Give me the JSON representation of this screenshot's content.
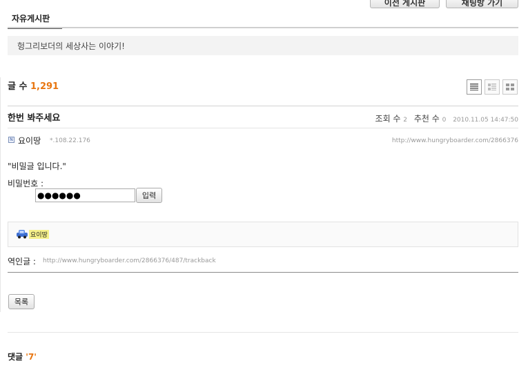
{
  "header": {
    "prev_button": "이전 게시판",
    "chat_button": "채팅방 가기"
  },
  "board": {
    "tab_title": "자유게시판",
    "description": "헝그리보더의 세상사는 이야기!",
    "count_label": "글 수",
    "count_value": "1,291"
  },
  "view_modes": [
    "list-view-icon",
    "summary-view-icon",
    "grid-view-icon"
  ],
  "post": {
    "title": "한번 봐주세요",
    "views_label": "조회 수",
    "views": "2",
    "recommend_label": "추천 수",
    "recommend": "0",
    "datetime": "2010.11.05 14:47:50",
    "author": "요이땅",
    "ip": "*.108.22.176",
    "url": "http://www.hungryboarder.com/2866376",
    "secret_message": "\"비밀글 입니다.\"",
    "password_label": "비밀번호 :",
    "password_value": "●●●●●●",
    "submit_label": "입력",
    "signature_name": "요이땅",
    "trackback_label": "역인글 :",
    "trackback_url": "http://www.hungryboarder.com/2866376/487/trackback",
    "list_button": "목록"
  },
  "comments": {
    "label": "댓글",
    "count": "'7'"
  },
  "colors": {
    "accent_orange": "#e8750f",
    "rule": "#d2d2d2"
  }
}
